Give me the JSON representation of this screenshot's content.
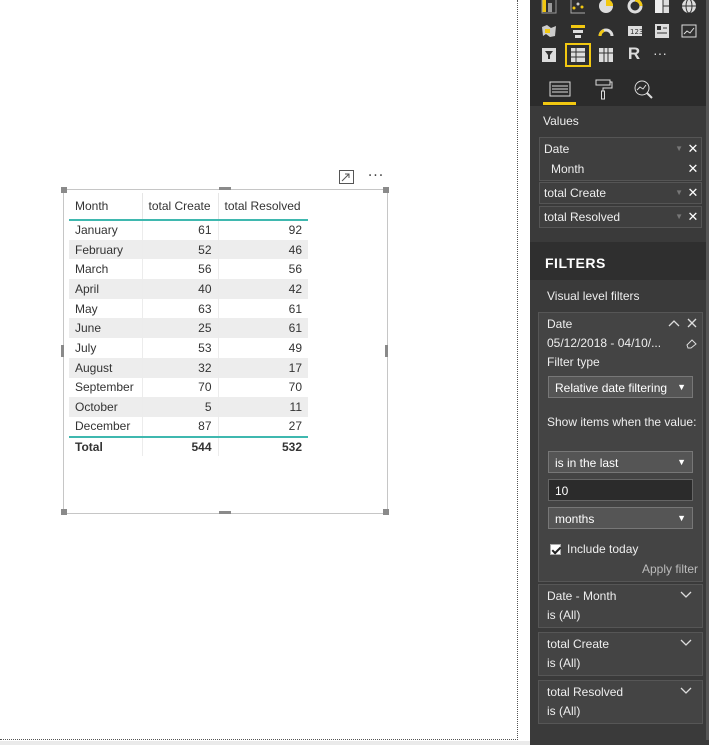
{
  "visual": {
    "more_glyph": "···",
    "table": {
      "headers": [
        "Month",
        "total Create",
        "total Resolved"
      ],
      "rows": [
        [
          "January",
          "61",
          "92"
        ],
        [
          "February",
          "52",
          "46"
        ],
        [
          "March",
          "56",
          "56"
        ],
        [
          "April",
          "40",
          "42"
        ],
        [
          "May",
          "63",
          "61"
        ],
        [
          "June",
          "25",
          "61"
        ],
        [
          "July",
          "53",
          "49"
        ],
        [
          "August",
          "32",
          "17"
        ],
        [
          "September",
          "70",
          "70"
        ],
        [
          "October",
          "5",
          "11"
        ],
        [
          "December",
          "87",
          "27"
        ]
      ],
      "total": [
        "Total",
        "544",
        "532"
      ]
    },
    "accent_color": "#3fb8af"
  },
  "pane": {
    "more_visuals_glyph": "···",
    "r_glyph": "R",
    "selected_color": "#f2c811",
    "values": {
      "label": "Values",
      "fields": [
        {
          "name": "Date",
          "sub": "Month"
        },
        {
          "name": "total Create"
        },
        {
          "name": "total Resolved"
        }
      ],
      "remove_glyph": "✕"
    },
    "filters": {
      "title": "FILTERS",
      "visual_level_label": "Visual level filters",
      "date_card": {
        "title": "Date",
        "range": "05/12/2018 - 04/10/...",
        "filter_type_label": "Filter type",
        "filter_type_value": "Relative date filtering",
        "show_items_label": "Show items when the value:",
        "operator_value": "is in the last",
        "amount_value": "10",
        "unit_value": "months",
        "include_today_label": "Include today",
        "include_today_checked": true,
        "apply_label": "Apply filter"
      },
      "collapsed_cards": [
        {
          "title": "Date - Month",
          "sub": "is (All)"
        },
        {
          "title": "total Create",
          "sub": "is (All)"
        },
        {
          "title": "total Resolved",
          "sub": "is (All)"
        }
      ]
    }
  }
}
